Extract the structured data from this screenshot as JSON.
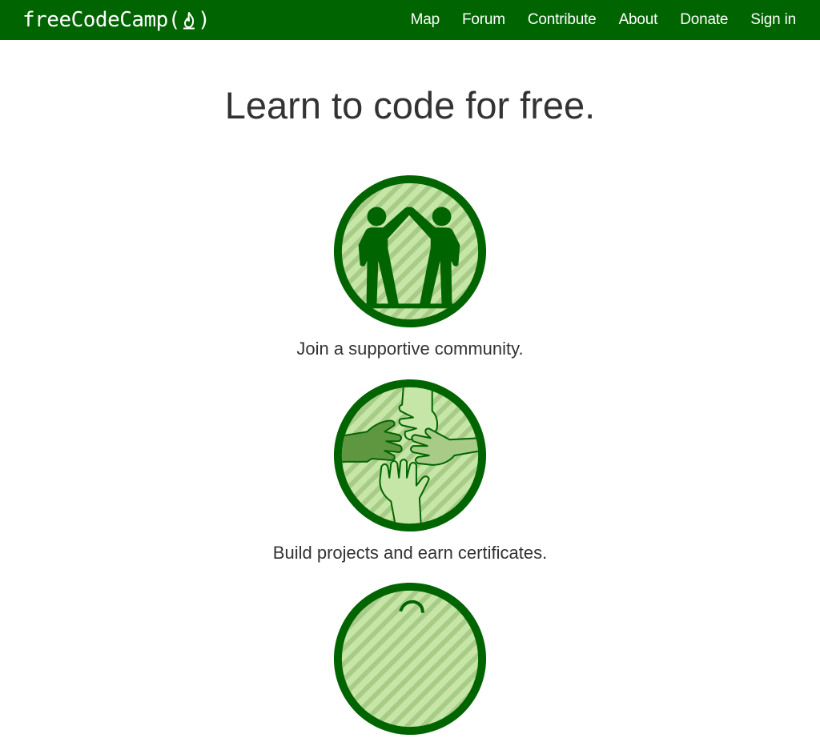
{
  "navbar": {
    "logo_text_before": "freeCodeCamp(",
    "logo_text_after": ")",
    "links": [
      "Map",
      "Forum",
      "Contribute",
      "About",
      "Donate",
      "Sign in"
    ]
  },
  "main": {
    "headline": "Learn to code for free.",
    "features": [
      {
        "caption": "Join a supportive community.",
        "icon": "high-five-icon"
      },
      {
        "caption": "Build projects and earn certificates.",
        "icon": "hands-together-icon"
      },
      {
        "caption": "",
        "icon": "partially-visible-icon"
      }
    ]
  },
  "colors": {
    "brand_green": "#006400",
    "light_green": "#c5e6a6",
    "stripe_green": "#a8cc88",
    "medium_green": "#5f9741",
    "text": "#333333"
  }
}
